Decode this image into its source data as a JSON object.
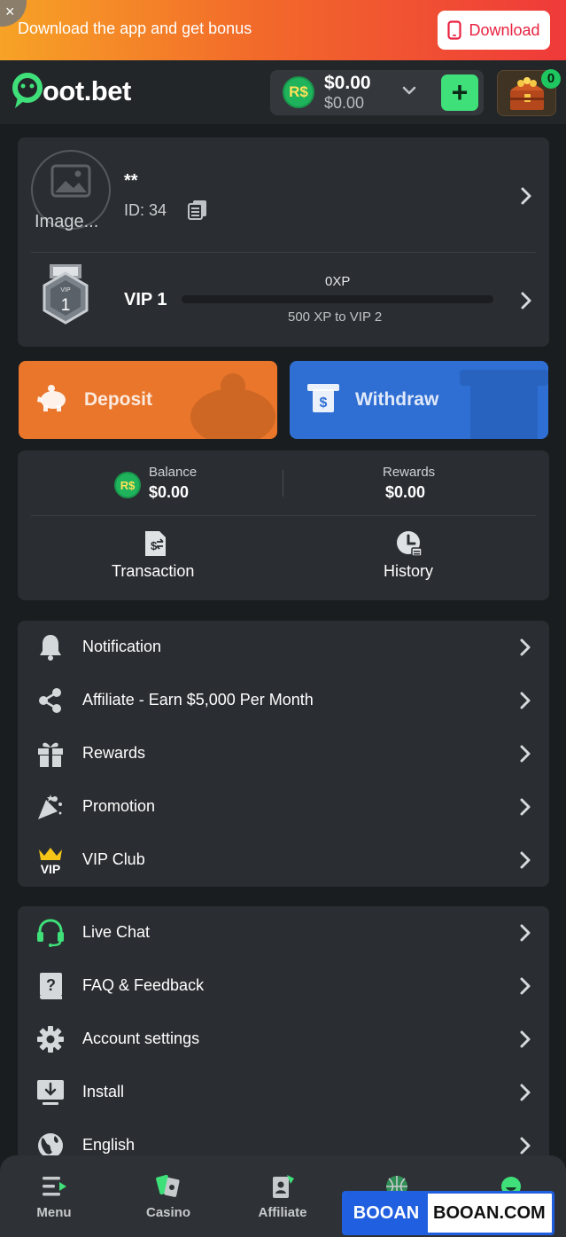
{
  "promo": {
    "close_glyph": "×",
    "text": "Download the app and get bonus",
    "button_label": "Download"
  },
  "header": {
    "logo_text": "oot.bet",
    "currency_symbol": "R$",
    "balance": "$0.00",
    "balance_sub": "$0.00",
    "add_glyph": "+",
    "chest_count": "0"
  },
  "profile": {
    "avatar_alt": "Image...",
    "username": "**",
    "id_text": "ID: 34",
    "vip_badge_number": "1",
    "vip_level": "VIP 1",
    "xp_value": "0XP",
    "xp_progress": 0,
    "xp_next": "500 XP to VIP 2"
  },
  "actions": {
    "deposit_label": "Deposit",
    "withdraw_label": "Withdraw"
  },
  "balance_card": {
    "currency_symbol": "R$",
    "balance_title": "Balance",
    "balance_value": "$0.00",
    "rewards_title": "Rewards",
    "rewards_value": "$0.00",
    "transaction_label": "Transaction",
    "history_label": "History"
  },
  "menu_primary": [
    {
      "label": "Notification",
      "icon": "bell-icon"
    },
    {
      "label": "Affiliate - Earn $5,000 Per Month",
      "icon": "share-icon"
    },
    {
      "label": "Rewards",
      "icon": "gift-icon"
    },
    {
      "label": "Promotion",
      "icon": "party-popper-icon"
    },
    {
      "label": "VIP Club",
      "icon": "vip-crown-icon"
    }
  ],
  "menu_secondary": [
    {
      "label": "Live Chat",
      "icon": "headset-icon"
    },
    {
      "label": "FAQ & Feedback",
      "icon": "question-book-icon"
    },
    {
      "label": "Account settings",
      "icon": "gear-icon"
    },
    {
      "label": "Install",
      "icon": "download-screen-icon"
    },
    {
      "label": "English",
      "icon": "globe-icon"
    }
  ],
  "bottom_nav": {
    "menu": "Menu",
    "casino": "Casino",
    "affiliate": "Affiliate"
  },
  "watermark": {
    "left": "BOOAN",
    "right": "BOOAN.COM"
  },
  "colors": {
    "accent_green": "#3fe07a",
    "deposit_orange": "#e9762b",
    "withdraw_blue": "#2f6fd4",
    "card_bg": "#2a2d31",
    "page_bg": "#1a1d20"
  }
}
